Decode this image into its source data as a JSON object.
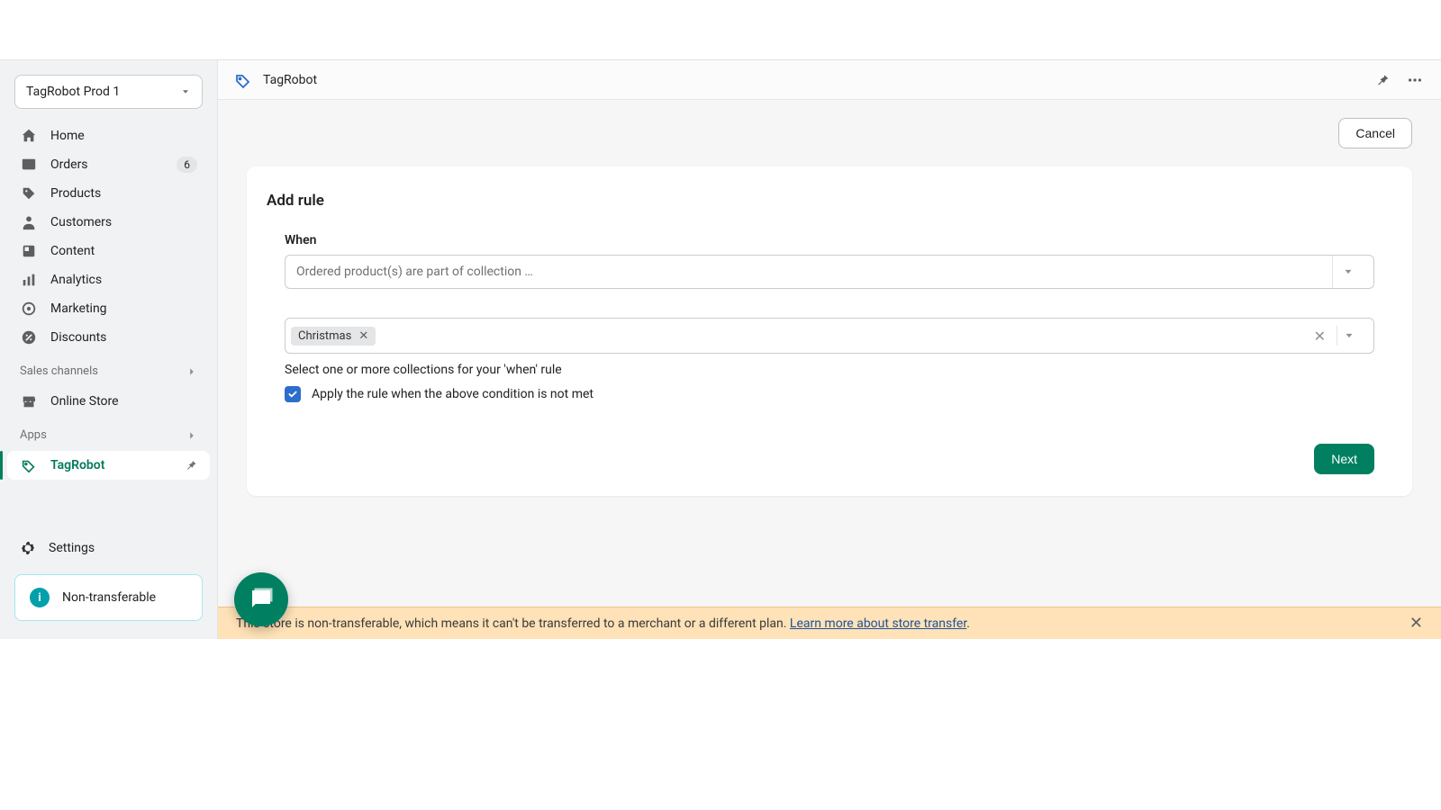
{
  "store_switcher": {
    "label": "TagRobot Prod 1"
  },
  "sidebar": {
    "items": [
      {
        "label": "Home",
        "icon": "home-icon",
        "badge": null
      },
      {
        "label": "Orders",
        "icon": "orders-icon",
        "badge": "6"
      },
      {
        "label": "Products",
        "icon": "products-icon",
        "badge": null
      },
      {
        "label": "Customers",
        "icon": "customers-icon",
        "badge": null
      },
      {
        "label": "Content",
        "icon": "content-icon",
        "badge": null
      },
      {
        "label": "Analytics",
        "icon": "analytics-icon",
        "badge": null
      },
      {
        "label": "Marketing",
        "icon": "marketing-icon",
        "badge": null
      },
      {
        "label": "Discounts",
        "icon": "discounts-icon",
        "badge": null
      }
    ],
    "sales_channels_header": "Sales channels",
    "sales_channels": [
      {
        "label": "Online Store"
      }
    ],
    "apps_header": "Apps",
    "apps": [
      {
        "label": "TagRobot",
        "active": true
      }
    ],
    "settings_label": "Settings",
    "info_card_label": "Non-transferable"
  },
  "topbar": {
    "app_name": "TagRobot"
  },
  "actions": {
    "cancel": "Cancel",
    "next": "Next"
  },
  "card": {
    "title": "Add rule",
    "when_label": "When",
    "when_select_value": "Ordered product(s) are part of collection …",
    "collections_chip": "Christmas",
    "helper_text": "Select one or more collections for your 'when' rule",
    "checkbox_label": "Apply the rule when the above condition is not met",
    "checkbox_checked": true
  },
  "banner": {
    "text_prefix": "This store is non-transferable, which means it can't be transferred to a merchant or a different plan. ",
    "link_text": "Learn more about store transfer",
    "text_suffix": "."
  }
}
